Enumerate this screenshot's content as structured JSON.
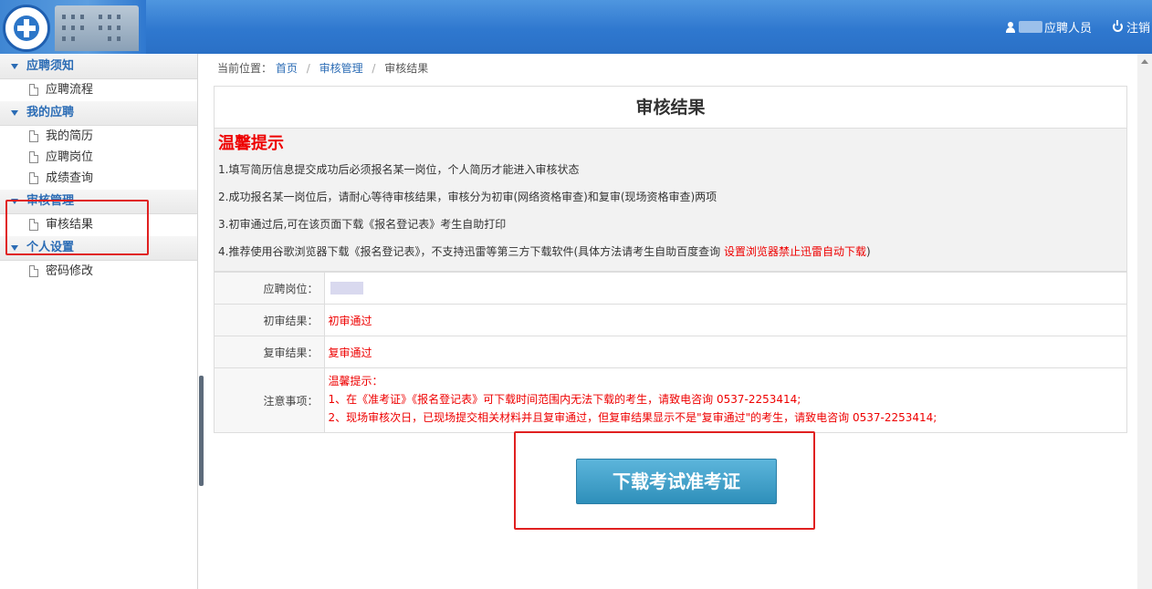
{
  "header": {
    "user_label": "应聘人员",
    "logout_label": "注销"
  },
  "sidebar": {
    "groups": [
      {
        "title": "应聘须知",
        "items": [
          {
            "label": "应聘流程"
          }
        ]
      },
      {
        "title": "我的应聘",
        "items": [
          {
            "label": "我的简历"
          },
          {
            "label": "应聘岗位"
          },
          {
            "label": "成绩查询"
          }
        ]
      },
      {
        "title": "审核管理",
        "items": [
          {
            "label": "审核结果"
          }
        ]
      },
      {
        "title": "个人设置",
        "items": [
          {
            "label": "密码修改"
          }
        ]
      }
    ]
  },
  "breadcrumb": {
    "prefix": "当前位置：",
    "home": "首页",
    "section": "审核管理",
    "current": "审核结果",
    "separator": "/"
  },
  "main": {
    "title": "审核结果",
    "tips_heading": "温馨提示",
    "tips": [
      "1.填写简历信息提交成功后必须报名某一岗位，个人简历才能进入审核状态",
      "2.成功报名某一岗位后，请耐心等待审核结果，审核分为初审(网络资格审查)和复审(现场资格审查)两项",
      "3.初审通过后,可在该页面下载《报名登记表》考生自助打印"
    ],
    "tip4_prefix": "4.推荐使用谷歌浏览器下载《报名登记表》，不支持迅雷等第三方下载软件(具体方法请考生自助百度查询 ",
    "tip4_link": "设置浏览器禁止迅雷自动下载",
    "tip4_suffix": ")",
    "rows": {
      "position_label": "应聘岗位：",
      "first_review_label": "初审结果：",
      "first_review_value": "初审通过",
      "second_review_label": "复审结果：",
      "second_review_value": "复审通过",
      "notes_label": "注意事项："
    },
    "notes": [
      "温馨提示：",
      "1、在《准考证》《报名登记表》可下载时间范围内无法下载的考生，请致电咨询 0537-2253414;",
      "2、现场审核次日，已现场提交相关材料并且复审通过，但复审结果显示不是\"复审通过\"的考生，请致电咨询 0537-2253414;"
    ],
    "download_button": "下载考试准考证"
  },
  "colors": {
    "header_blue": "#2f78cf",
    "accent_blue": "#2b6cb5",
    "alert_red": "#e00000",
    "button_blue": "#3c9cc6"
  }
}
